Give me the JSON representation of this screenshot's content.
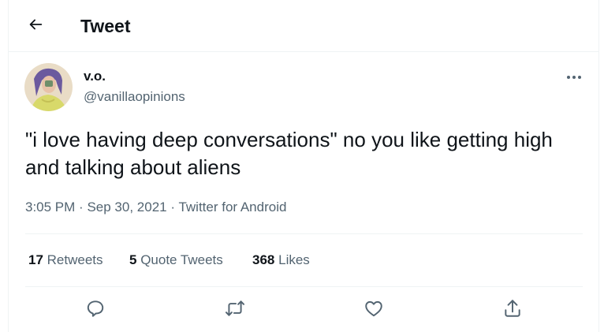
{
  "header": {
    "title": "Tweet",
    "back_icon": "arrow-left-icon"
  },
  "tweet": {
    "author": {
      "display_name": "v.o.",
      "handle": "@vanillaopinions"
    },
    "more_icon": "more-horizontal-icon",
    "text": "\"i love having deep conversations\" no you like getting high and talking about aliens",
    "meta": {
      "time": "3:05 PM",
      "separator": "·",
      "date": "Sep 30, 2021",
      "source": "Twitter for Android"
    },
    "stats": [
      {
        "count": "17",
        "label": "Retweets"
      },
      {
        "count": "5",
        "label": "Quote Tweets"
      },
      {
        "count": "368",
        "label": "Likes"
      }
    ],
    "actions": [
      {
        "icon": "reply-icon"
      },
      {
        "icon": "retweet-icon"
      },
      {
        "icon": "like-heart-icon"
      },
      {
        "icon": "share-icon"
      }
    ]
  },
  "colors": {
    "text": "#0f1419",
    "secondary": "#536471",
    "border": "#eff3f4",
    "avatar_bg": "#e9dcc6"
  }
}
